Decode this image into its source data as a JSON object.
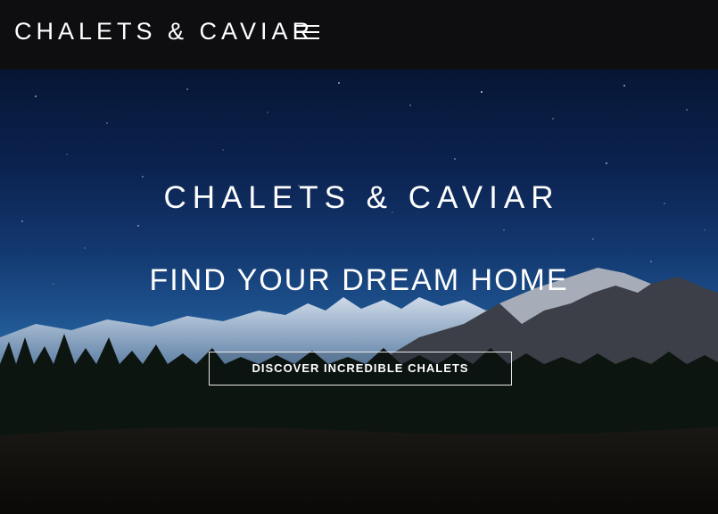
{
  "header": {
    "brand": "CHALETS & CAVIAR",
    "menu_icon": "hamburger-menu-icon"
  },
  "hero": {
    "title": "CHALETS & CAVIAR",
    "subtitle": "FIND YOUR DREAM HOME",
    "cta_label": "DISCOVER INCREDIBLE CHALETS",
    "background": "night-mountain-landscape-image"
  },
  "colors": {
    "header_bg": "#0e0e10",
    "text": "#ffffff",
    "sky_top": "#071634",
    "sky_horizon": "#2a6aa6"
  }
}
